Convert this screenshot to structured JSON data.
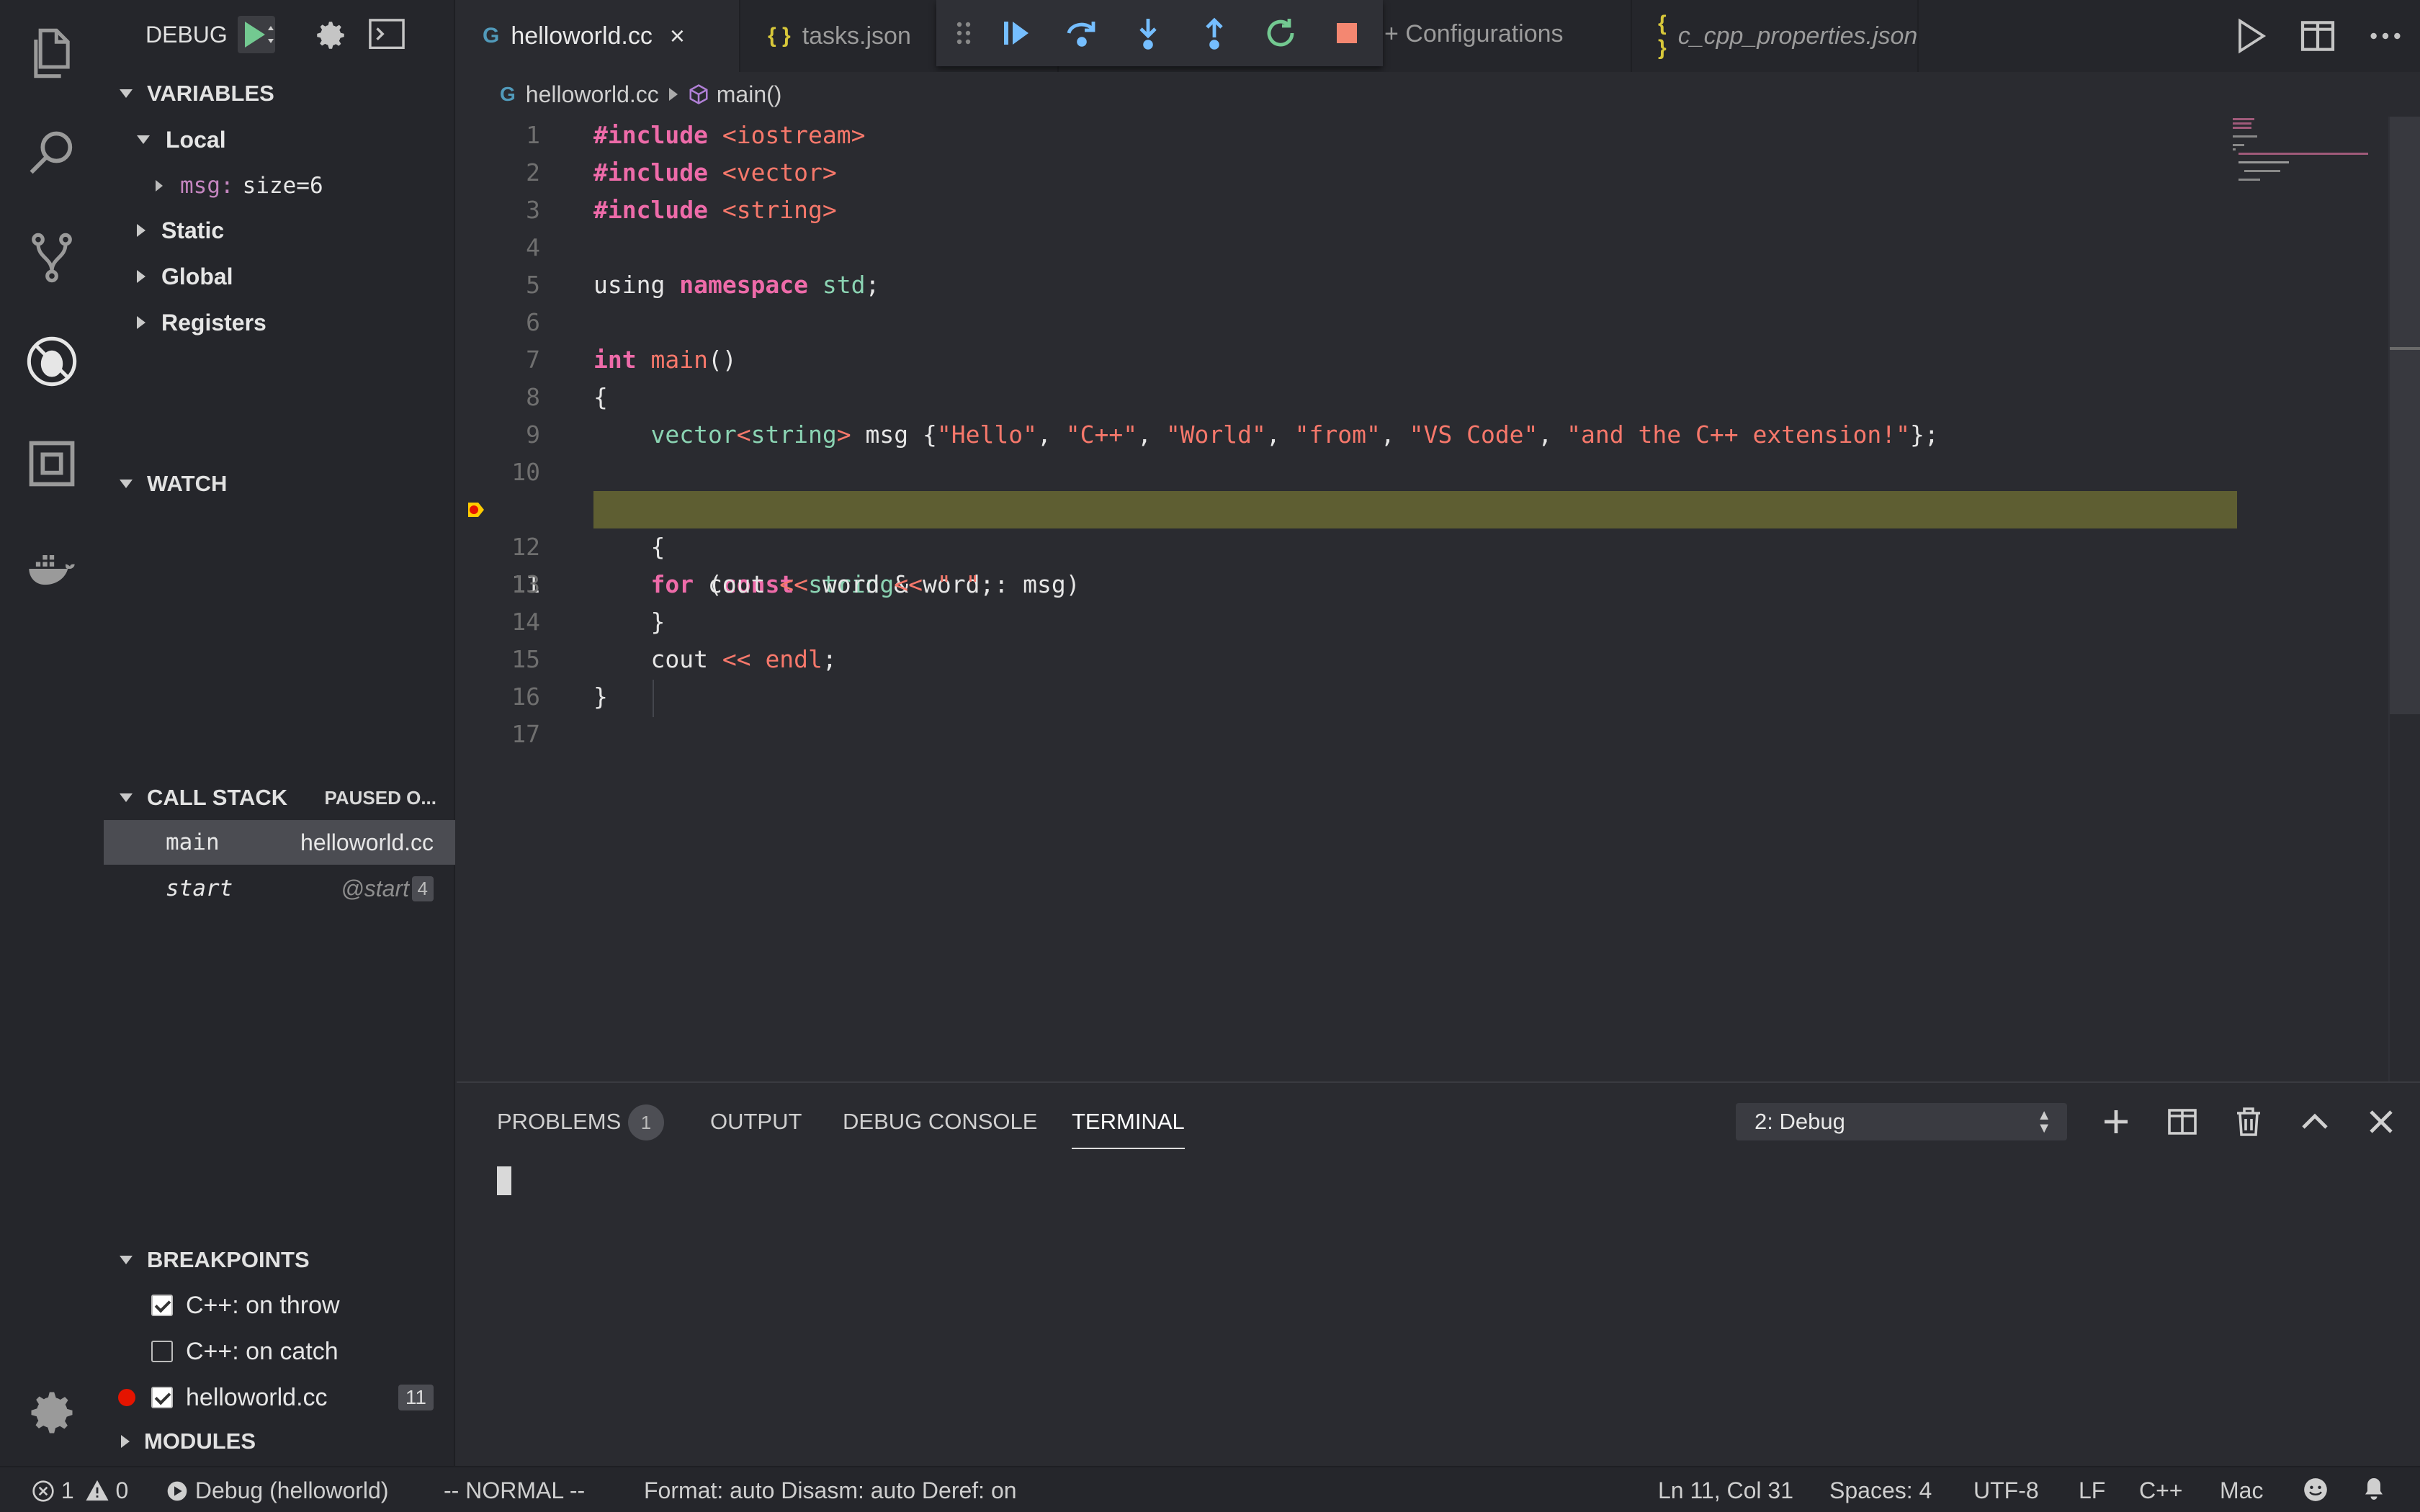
{
  "sidebar": {
    "title": "DEBUG",
    "variables": {
      "header": "VARIABLES",
      "local": "Local",
      "msg_name": "msg:",
      "msg_value": "size=6",
      "static": "Static",
      "global": "Global",
      "registers": "Registers"
    },
    "watch": {
      "header": "WATCH"
    },
    "call_stack": {
      "header": "CALL STACK",
      "status": "PAUSED O...",
      "frames": [
        {
          "fn": "main",
          "file": "helloworld.cc"
        },
        {
          "fn": "start",
          "file": "@start",
          "line": "4"
        }
      ]
    },
    "breakpoints": {
      "header": "BREAKPOINTS",
      "items": [
        {
          "label": "C++: on throw",
          "checked": true
        },
        {
          "label": "C++: on catch",
          "checked": false
        },
        {
          "label": "helloworld.cc",
          "checked": true,
          "line": "11"
        }
      ]
    },
    "modules": {
      "header": "MODULES"
    }
  },
  "tabs": [
    {
      "label": "helloworld.cc",
      "icon": "cpp-file-icon",
      "active": true
    },
    {
      "label": "tasks.json",
      "icon": "json-file-icon"
    },
    {
      "label": "+ Configurations"
    },
    {
      "label": "c_cpp_properties.json",
      "icon": "json-file-icon"
    }
  ],
  "icon_glyphs": {
    "json": "{ }",
    "close": "×"
  },
  "breadcrumb": {
    "file": "helloworld.cc",
    "symbol": "main()"
  },
  "editor": {
    "current_line": 11,
    "highlight_color": "#5e5e32"
  },
  "panel": {
    "tabs": {
      "problems": "PROBLEMS",
      "problems_count": "1",
      "output": "OUTPUT",
      "debug_console": "DEBUG CONSOLE",
      "terminal": "TERMINAL"
    },
    "terminal_select": "2: Debug"
  },
  "status": {
    "errors": "1",
    "warnings": "0",
    "debug_target": "Debug (helloworld)",
    "vim_mode": "-- NORMAL --",
    "format": "Format: auto  Disasm: auto  Deref: on",
    "position": "Ln 11, Col 31",
    "spaces": "Spaces: 4",
    "encoding": "UTF-8",
    "eol": "LF",
    "language": "C++",
    "platform": "Mac"
  },
  "colors": {
    "accent_green": "#73c991",
    "breakpoint_red": "#e51400",
    "stop_red": "#f48771",
    "debug_blue": "#75beff"
  }
}
